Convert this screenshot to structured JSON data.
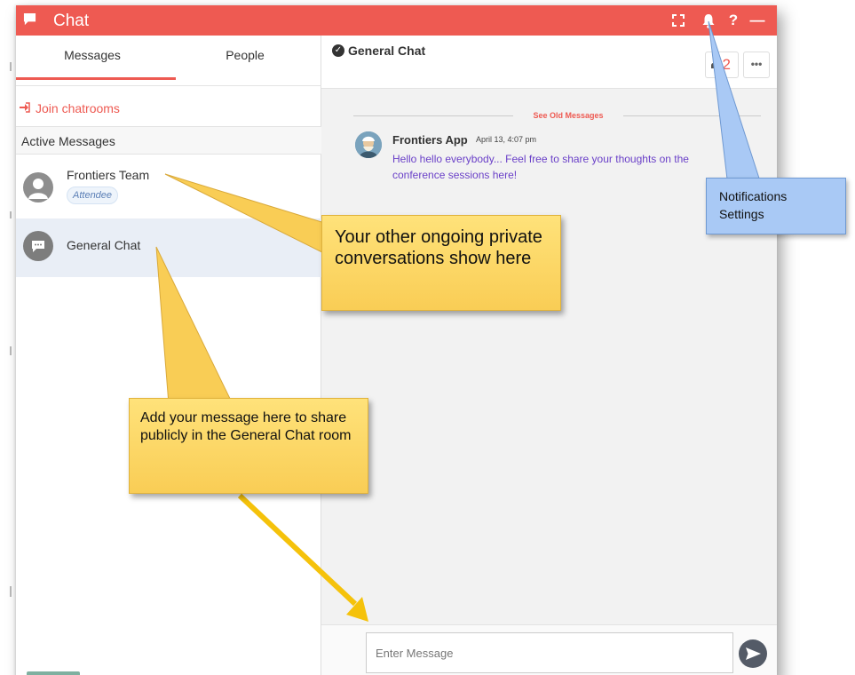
{
  "window": {
    "title": "Chat"
  },
  "titlebar": {
    "icons": [
      "chat-bubble-icon",
      "fullscreen-icon",
      "bell-icon",
      "help-icon",
      "minimize-icon"
    ],
    "help_label": "?",
    "minimize_label": "—"
  },
  "tabs": [
    {
      "label": "Messages",
      "active": true
    },
    {
      "label": "People",
      "active": false
    }
  ],
  "sidebar": {
    "join_label": "Join chatrooms",
    "active_header": "Active Messages",
    "conversations": [
      {
        "name": "Frontiers Team",
        "badge": "Attendee",
        "icon": "user-avatar-icon"
      },
      {
        "name": "General Chat",
        "badge": "",
        "icon": "chat-room-icon",
        "selected": true
      }
    ]
  },
  "room": {
    "title": "General Chat",
    "member_count": "2",
    "more_label": "•••",
    "see_old": "See Old Messages"
  },
  "messages": [
    {
      "author": "Frontiers App",
      "time": "April 13, 4:07 pm",
      "text": "Hello hello everybody... Feel free to share your thoughts on the conference sessions here!"
    }
  ],
  "composer": {
    "placeholder": "Enter Message"
  },
  "callouts": {
    "private": "Your other ongoing private conversations show here",
    "message": "Add your message here to share publicly in the General Chat room",
    "notifications": "Notifications Settings"
  },
  "colors": {
    "accent": "#ee5a52",
    "callout": "#f9cd55",
    "note": "#a9c9f5",
    "message_text": "#6a40c8"
  }
}
